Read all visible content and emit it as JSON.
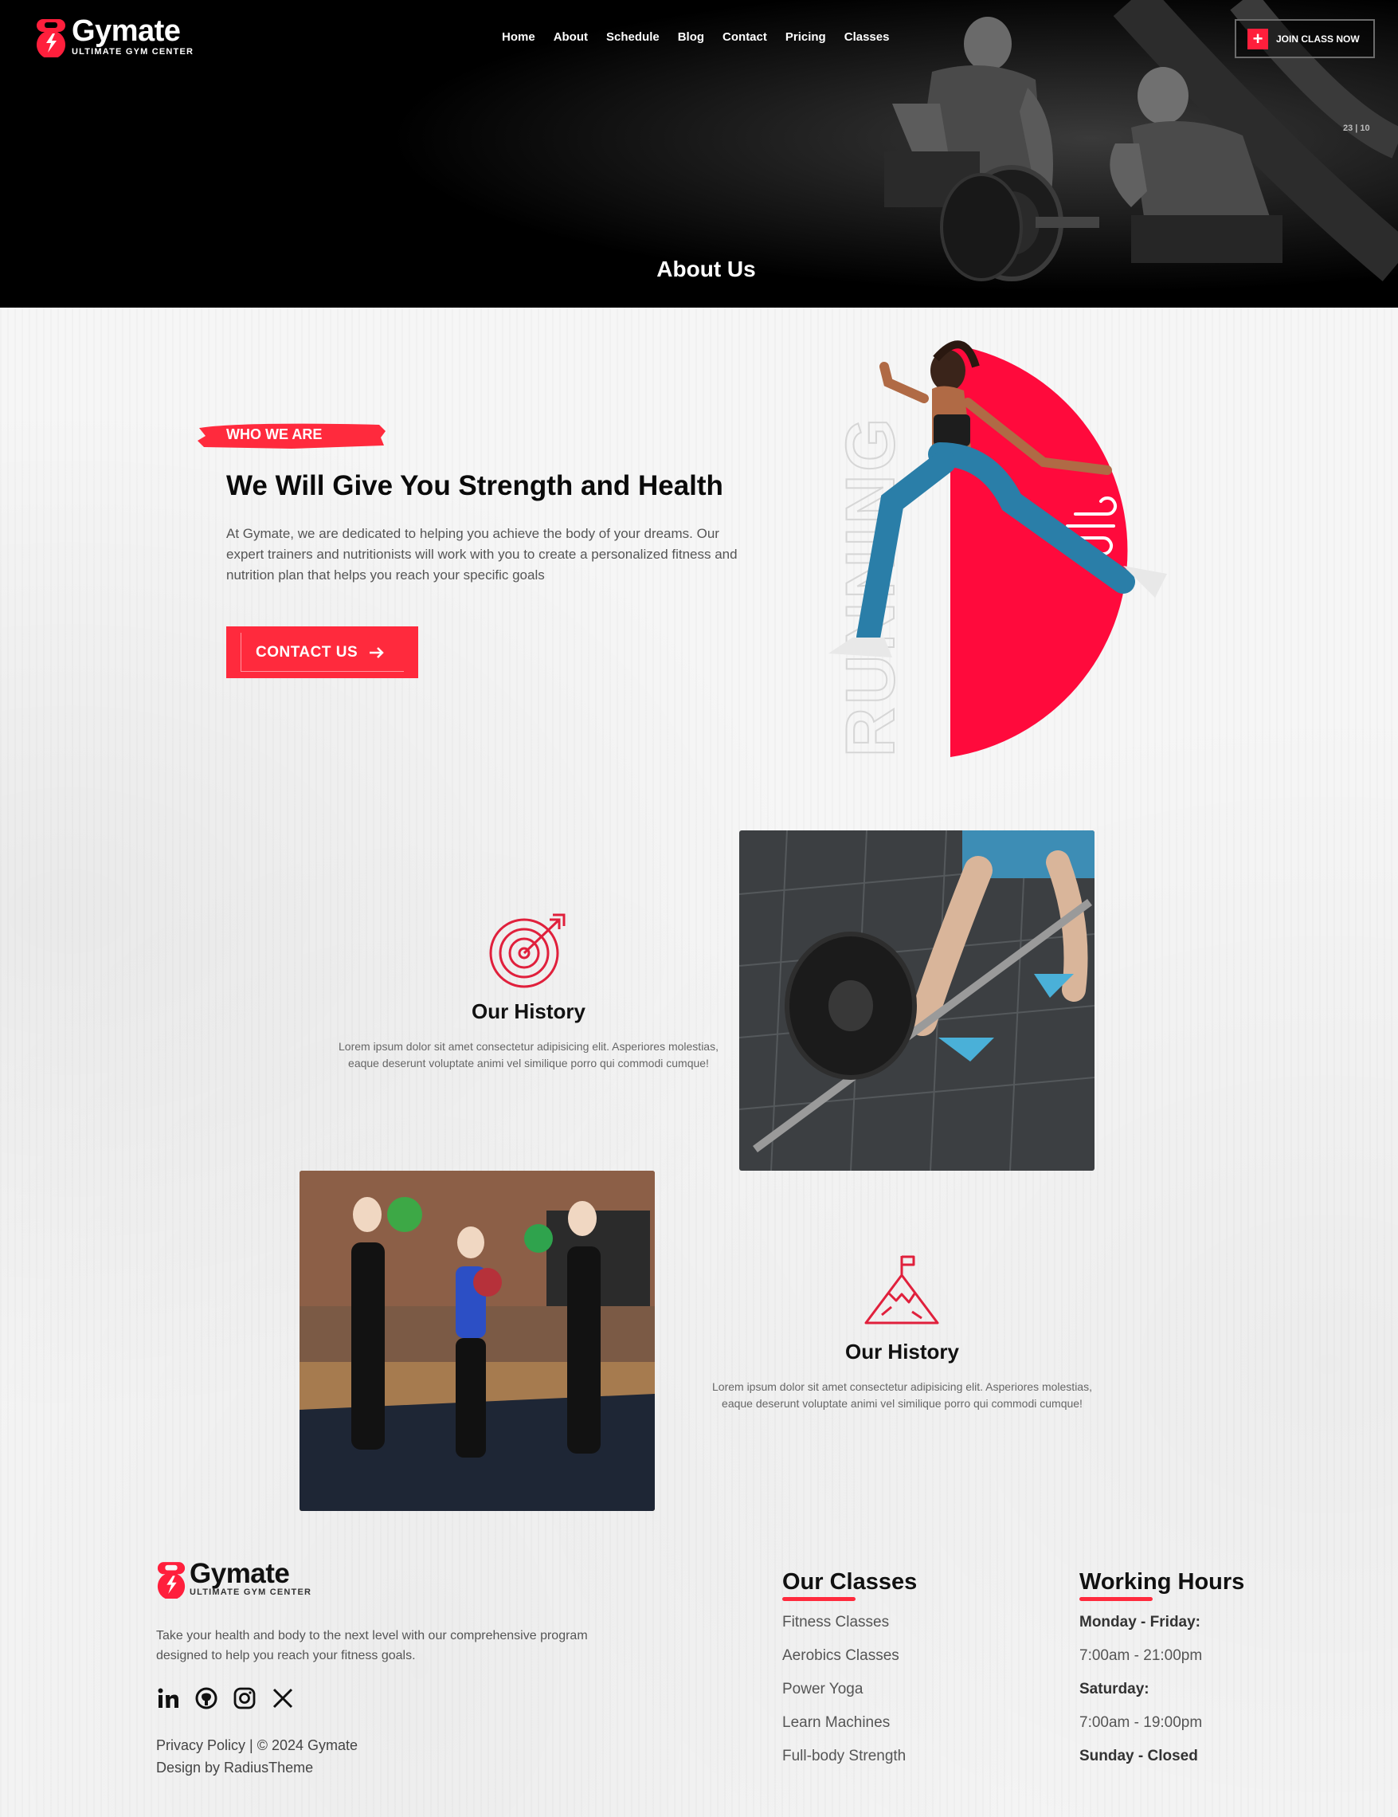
{
  "brand": {
    "name": "Gymate",
    "tagline": "ULTIMATE GYM CENTER"
  },
  "nav": {
    "items": [
      "Home",
      "About",
      "Schedule",
      "Blog",
      "Contact",
      "Pricing",
      "Classes"
    ],
    "join_label": "JOIN CLASS NOW"
  },
  "hero": {
    "title": "About Us",
    "tiny_text": "23 | 10"
  },
  "who": {
    "tag": "WHO WE ARE",
    "title": "We Will Give You Strength and Health",
    "text": "At Gymate, we are dedicated to helping you achieve the body of your dreams. Our expert trainers and nutritionists will work with you to create a personalized fitness and nutrition plan that helps you reach your specific goals",
    "button_label": "CONTACT US",
    "side_word": "RUNNING"
  },
  "history": [
    {
      "title": "Our History",
      "text": "Lorem ipsum dolor sit amet consectetur adipisicing elit. Asperiores molestias, eaque deserunt voluptate animi vel similique porro qui commodi cumque!",
      "icon": "target-icon"
    },
    {
      "title": "Our History",
      "text": "Lorem ipsum dolor sit amet consectetur adipisicing elit. Asperiores molestias, eaque deserunt voluptate animi vel similique porro qui commodi cumque!",
      "icon": "mountain-flag-icon"
    }
  ],
  "footer": {
    "about": "Take your health and body to the next level with our comprehensive program designed to help you reach your fitness goals.",
    "socials": [
      "linkedin-icon",
      "github-icon",
      "instagram-icon",
      "x-icon"
    ],
    "copyright": "Privacy Policy | © 2024 Gymate",
    "credit": "Design by RadiusTheme",
    "classes": {
      "title": "Our Classes",
      "items": [
        "Fitness Classes",
        "Aerobics Classes",
        "Power Yoga",
        "Learn Machines",
        "Full-body Strength"
      ]
    },
    "hours": {
      "title": "Working Hours",
      "items": [
        "Monday - Friday:",
        "7:00am - 21:00pm",
        "Saturday:",
        "7:00am - 19:00pm",
        "Sunday - Closed"
      ]
    }
  },
  "colors": {
    "accent": "#ff2a3d",
    "dark": "#000000",
    "text": "#555555"
  }
}
